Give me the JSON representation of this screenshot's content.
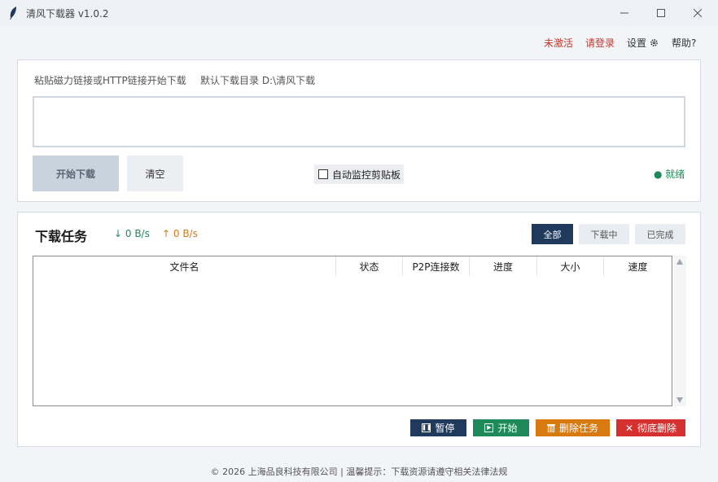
{
  "window": {
    "title": "清风下载器 v1.0.2"
  },
  "topnav": {
    "activate": "未激活",
    "login": "请登录",
    "settings": "设置",
    "help": "帮助?"
  },
  "input_panel": {
    "hint": "粘贴磁力链接或HTTP链接开始下载",
    "dir_label": "默认下载目录  D:\\清风下载",
    "link_value": "",
    "start_label": "开始下载",
    "clear_label": "清空",
    "monitor_label": "自动监控剪贴板",
    "monitor_checked": false,
    "status": "● 就绪"
  },
  "tasks": {
    "title": "下载任务",
    "speed_down": "↓ 0 B/s",
    "speed_up": "↑ 0 B/s",
    "filters": [
      "全部",
      "下载中",
      "已完成"
    ],
    "active_filter": "全部",
    "columns": [
      "文件名",
      "状态",
      "P2P连接数",
      "进度",
      "大小",
      "速度"
    ],
    "rows": [],
    "actions": {
      "pause": "暂停",
      "start": "开始",
      "delete": "删除任务",
      "purge": "彻底删除"
    }
  },
  "footer": "© 2026 上海品良科技有限公司 | 温馨提示：下载资源请遵守相关法律法规",
  "colors": {
    "accent_navy": "#1f3a5c",
    "green": "#1e8a5a",
    "orange": "#d97a10",
    "red": "#d63030",
    "nav_red": "#c0392b"
  }
}
